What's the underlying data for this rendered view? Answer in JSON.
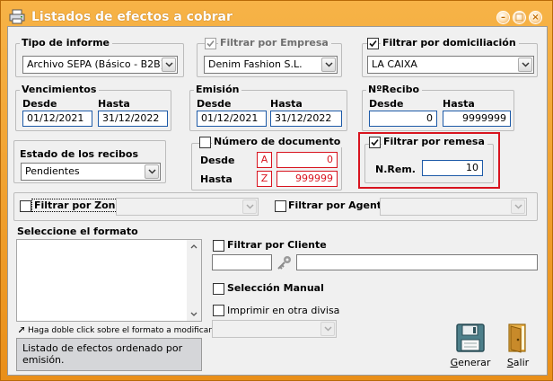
{
  "window": {
    "title": "Listados de efectos a cobrar"
  },
  "tipo_informe": {
    "label": "Tipo de informe",
    "value": "Archivo SEPA (Básico - B2B)"
  },
  "filtrar_empresa": {
    "label": "Filtrar por Empresa",
    "checked": true,
    "value": "Denim Fashion S.L."
  },
  "filtrar_domiciliacion": {
    "label": "Filtrar por domiciliación",
    "checked": true,
    "value": "LA CAIXA"
  },
  "vencimientos": {
    "label": "Vencimientos",
    "desde_label": "Desde",
    "hasta_label": "Hasta",
    "desde": "01/12/2021",
    "hasta": "31/12/2022"
  },
  "emision": {
    "label": "Emisión",
    "desde_label": "Desde",
    "hasta_label": "Hasta",
    "desde": "01/12/2021",
    "hasta": "31/12/2022"
  },
  "nrecibo": {
    "label": "NºRecibo",
    "desde_label": "Desde",
    "hasta_label": "Hasta",
    "desde": "0",
    "hasta": "9999999"
  },
  "estado_recibos": {
    "label": "Estado de los recibos",
    "value": "Pendientes"
  },
  "numero_documento": {
    "label": "Número de documento",
    "desde_label": "Desde",
    "hasta_label": "Hasta",
    "desde_letter": "A",
    "hasta_letter": "Z",
    "desde": "0",
    "hasta": "999999"
  },
  "filtrar_remesa": {
    "label": "Filtrar por remesa",
    "checked": true,
    "nrem_label": "N.Rem.",
    "nrem": "10"
  },
  "filtrar_zona": {
    "label": "Filtrar por Zona",
    "checked": false,
    "value": ""
  },
  "filtrar_agente": {
    "label": "Filtrar por Agente",
    "checked": false,
    "value": ""
  },
  "formato": {
    "label": "Seleccione el formato",
    "hint": "Haga doble click sobre el formato a modificar",
    "description": "Listado de efectos ordenado por emisión."
  },
  "filtrar_cliente": {
    "label": "Filtrar por Cliente",
    "checked": false,
    "code": "",
    "name": ""
  },
  "seleccion_manual": {
    "label": "Selección Manual",
    "checked": false
  },
  "otra_divisa": {
    "label": "Imprimir en otra divisa",
    "checked": false,
    "value": ""
  },
  "buttons": {
    "generar": {
      "first": "G",
      "rest": "enerar"
    },
    "salir": {
      "first": "S",
      "rest": "alir"
    }
  },
  "colors": {
    "title_bar": "#f0a028",
    "highlight_border": "#d8141f",
    "field_border": "#1d5aa8"
  }
}
